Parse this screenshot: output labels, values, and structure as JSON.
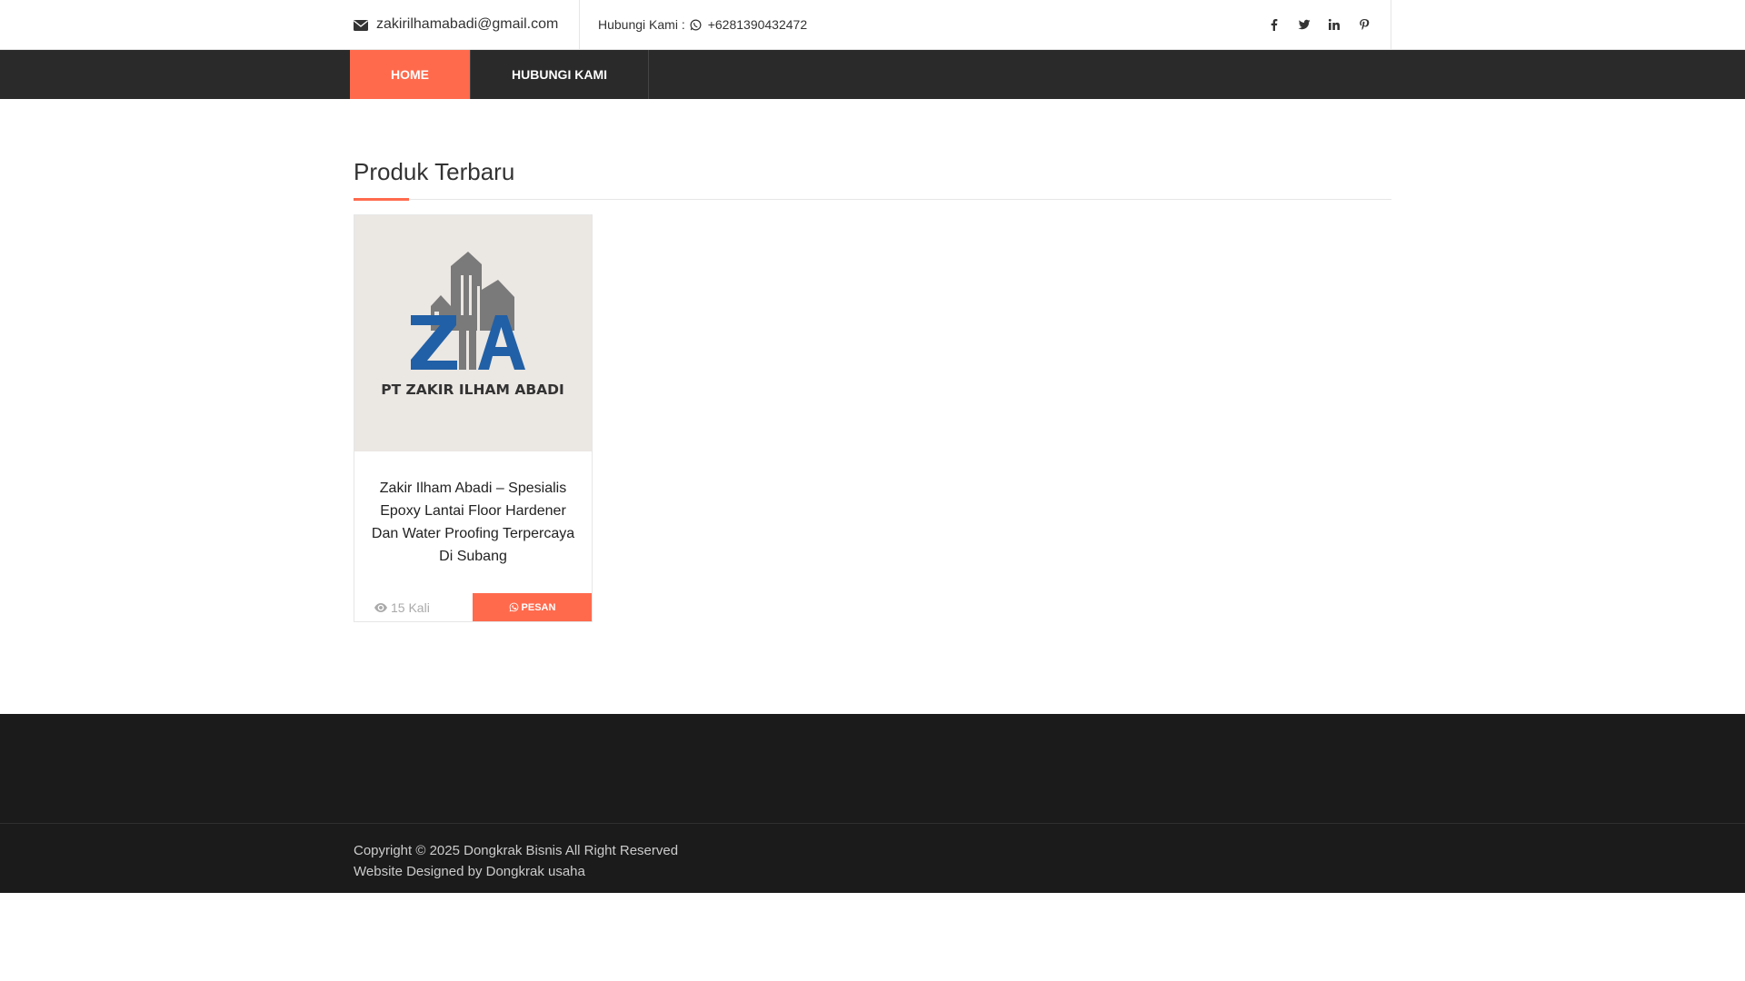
{
  "topbar": {
    "email": "zakirilhamabadi@gmail.com",
    "contact_label": "Hubungi Kami :",
    "phone": "+6281390432472",
    "social_icons": [
      "facebook-icon",
      "twitter-icon",
      "linkedin-icon",
      "pinterest-icon"
    ]
  },
  "nav": {
    "items": [
      {
        "label": "HOME",
        "active": true
      },
      {
        "label": "HUBUNGI KAMI",
        "active": false
      }
    ]
  },
  "main": {
    "section_title": "Produk Terbaru",
    "products": [
      {
        "image_logo_text": "PT ZAKIR ILHAM ABADI",
        "title": "Zakir Ilham Abadi – Spesialis Epoxy Lantai Floor Hardener Dan Water Proofing Terpercaya Di Subang",
        "views": "15 Kali",
        "button_label": "PESAN"
      }
    ]
  },
  "footer": {
    "copyright": "Copyright © 2025 Dongkrak Bisnis All Right Reserved",
    "designed_by": "Website Designed by Dongkrak usaha"
  },
  "colors": {
    "accent": "#ff6a4d",
    "nav_bg": "#2a2a2a",
    "footer_bg": "#1b1b1b",
    "logo_blue": "#2160a6",
    "logo_gray": "#7a7a7a"
  }
}
